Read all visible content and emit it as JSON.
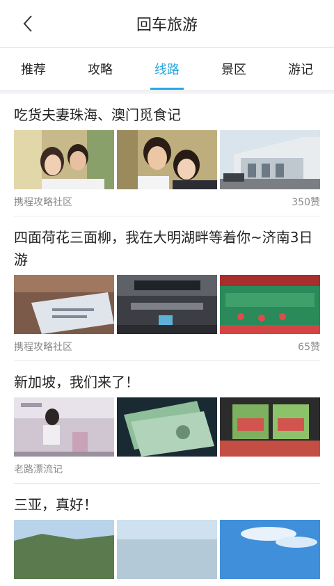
{
  "header": {
    "title": "回车旅游",
    "back_icon": "chevron-left-icon"
  },
  "tabs": [
    {
      "label": "推荐"
    },
    {
      "label": "攻略"
    },
    {
      "label": "线路",
      "active": true
    },
    {
      "label": "景区"
    },
    {
      "label": "游记"
    }
  ],
  "accent_color": "#29a9e1",
  "feed": [
    {
      "title": "吃货夫妻珠海、澳门觅食记",
      "source": "携程攻略社区",
      "likes": "350赞",
      "thumbs": [
        "couple-selfie-photo",
        "couple-selfie-photo-2",
        "building-street-photo"
      ]
    },
    {
      "title": "四面荷花三面柳，我在大明湖畔等着你~济南3日游",
      "source": "携程攻略社区",
      "likes": "65赞",
      "thumbs": [
        "train-ticket-photo",
        "station-hall-photo",
        "station-banner-photo"
      ]
    },
    {
      "title": "新加坡，我们来了！",
      "source": "老路漂流记",
      "likes": "",
      "thumbs": [
        "airport-traveler-photo",
        "banknotes-photo",
        "snack-packages-photo"
      ]
    },
    {
      "title": "三亚，真好！",
      "source": "",
      "likes": "",
      "thumbs": [
        "hill-landscape-photo",
        "sea-sky-photo",
        "beach-sky-photo"
      ]
    }
  ]
}
